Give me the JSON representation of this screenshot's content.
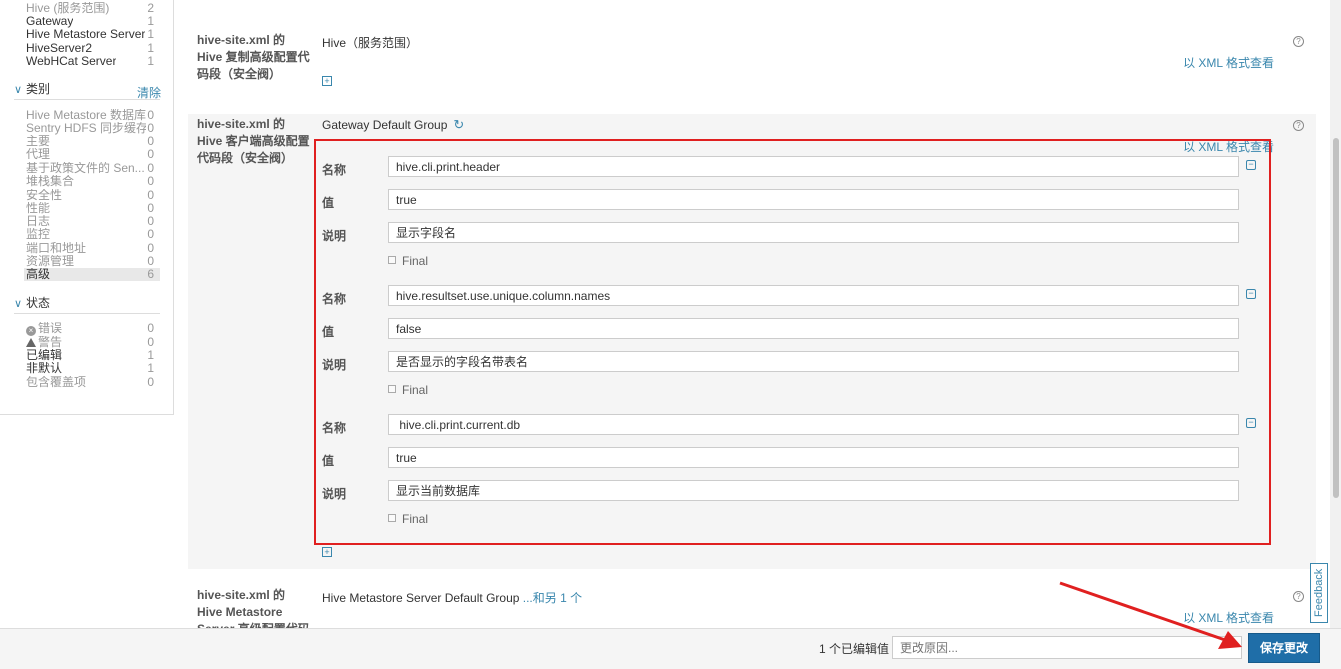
{
  "sidebar": {
    "scope_items": [
      {
        "label": "Hive (服务范围)",
        "count": "2"
      },
      {
        "label": "Gateway",
        "count": "1"
      },
      {
        "label": "Hive Metastore Server",
        "count": "1"
      },
      {
        "label": "HiveServer2",
        "count": "1"
      },
      {
        "label": "WebHCat Server",
        "count": "1"
      }
    ],
    "category_title": "类别",
    "clear_label": "清除",
    "category_items": [
      {
        "label": "Hive Metastore 数据库",
        "count": "0"
      },
      {
        "label": "Sentry HDFS 同步缓存",
        "count": "0"
      },
      {
        "label": "主要",
        "count": "0"
      },
      {
        "label": "代理",
        "count": "0"
      },
      {
        "label": "基于政策文件的 Sen...",
        "count": "0"
      },
      {
        "label": "堆栈集合",
        "count": "0"
      },
      {
        "label": "安全性",
        "count": "0"
      },
      {
        "label": "性能",
        "count": "0"
      },
      {
        "label": "日志",
        "count": "0"
      },
      {
        "label": "监控",
        "count": "0"
      },
      {
        "label": "端口和地址",
        "count": "0"
      },
      {
        "label": "资源管理",
        "count": "0"
      },
      {
        "label": "高级",
        "count": "6"
      }
    ],
    "status_title": "状态",
    "status_items": [
      {
        "label": "错误",
        "count": "0"
      },
      {
        "label": "警告",
        "count": "0"
      },
      {
        "label": "已编辑",
        "count": "1"
      },
      {
        "label": "非默认",
        "count": "1"
      },
      {
        "label": "包含覆盖项",
        "count": "0"
      }
    ]
  },
  "props": [
    {
      "name": "hive-site.xml 的 Hive 复制高级配置代码段（安全阀）",
      "scope": "Hive（服务范围）",
      "xml_link": "以 XML 格式查看"
    },
    {
      "name": "hive-site.xml 的 Hive 客户端高级配置代码段（安全阀）",
      "scope": "Gateway Default Group",
      "xml_link": "以 XML 格式查看",
      "labels": {
        "name": "名称",
        "value": "值",
        "desc": "说明",
        "final": "Final"
      },
      "entries": [
        {
          "name": "hive.cli.print.header",
          "value": "true",
          "desc": "显示字段名"
        },
        {
          "name": "hive.resultset.use.unique.column.names",
          "value": "false",
          "desc": "是否显示的字段名带表名"
        },
        {
          "name": " hive.cli.print.current.db",
          "value": "true",
          "desc": "显示当前数据库"
        }
      ]
    },
    {
      "name": "hive-site.xml 的 Hive Metastore Server 高级配置代码段（安全",
      "scope": "Hive Metastore Server Default Group",
      "more_link": "...和另 1 个",
      "xml_link": "以 XML 格式查看"
    }
  ],
  "footer": {
    "edited_count": "1 个已编辑值",
    "reason_placeholder": "更改原因...",
    "save_label": "保存更改"
  },
  "feedback_label": "Feedback",
  "colors": {
    "accent": "#3a87ad",
    "primary_button": "#1f6ea8",
    "highlight_border": "#e02020"
  }
}
